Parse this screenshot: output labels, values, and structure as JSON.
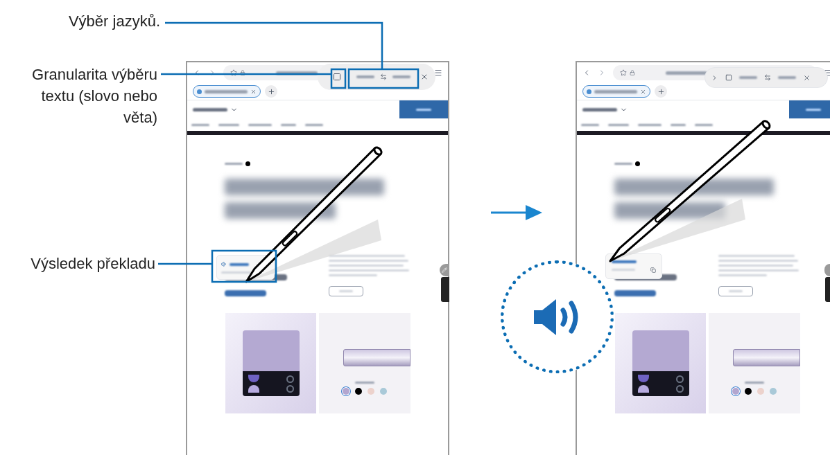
{
  "callouts": [
    {
      "text": "Výběr jazyků."
    },
    {
      "text": "Granularita výběru textu (slovo nebo věta)"
    },
    {
      "text": "Výsledek překladu"
    }
  ],
  "color_options": [
    {
      "color": "#b3a6cf",
      "selected": true
    },
    {
      "color": "#000000",
      "selected": false
    },
    {
      "color": "#ecd2cc",
      "selected": false
    },
    {
      "color": "#a9c9d8",
      "selected": false
    }
  ]
}
